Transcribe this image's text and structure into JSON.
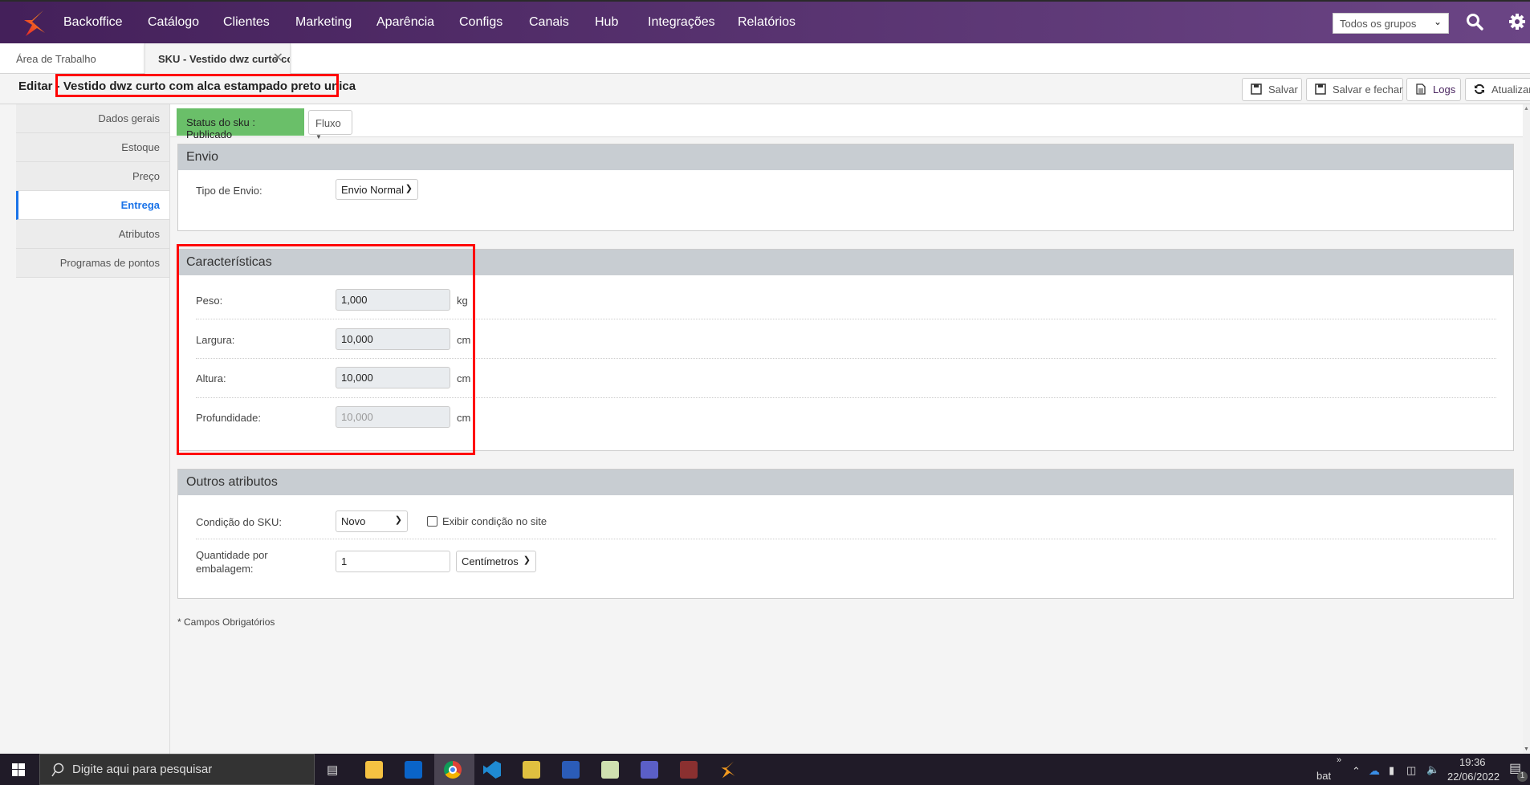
{
  "nav": {
    "items": [
      "Backoffice",
      "Catálogo",
      "Clientes",
      "Marketing",
      "Aparência",
      "Configs",
      "Canais",
      "Hub",
      "Integrações",
      "Relatórios"
    ],
    "group_select": "Todos os grupos",
    "colors": {
      "start": "#44205a",
      "end": "#6b4585"
    }
  },
  "tabs": {
    "workspace": "Área de Trabalho",
    "active": "SKU - Vestido dwz curto com alca estampado preto unica"
  },
  "header": {
    "title_prefix": "Editar - ",
    "title": "Vestido dwz curto com alca estampado preto unica"
  },
  "toolbar": {
    "save": "Salvar",
    "save_close": "Salvar e fechar",
    "logs": "Logs",
    "refresh": "Atualizar"
  },
  "sidebar": {
    "items": [
      "Dados gerais",
      "Estoque",
      "Preço",
      "Entrega",
      "Atributos",
      "Programas de pontos"
    ],
    "active": "Entrega"
  },
  "status": {
    "label": "Status do sku : Publicado",
    "flow": "Fluxo",
    "color": "#6abf69"
  },
  "envio": {
    "title": "Envio",
    "tipo_label": "Tipo de Envio:",
    "tipo_value": "Envio Normal"
  },
  "caracteristicas": {
    "title": "Características",
    "rows": [
      {
        "label": "Peso:",
        "value": "1,000",
        "unit": "kg"
      },
      {
        "label": "Largura:",
        "value": "10,000",
        "unit": "cm"
      },
      {
        "label": "Altura:",
        "value": "10,000",
        "unit": "cm"
      },
      {
        "label": "Profundidade:",
        "value": "10,000",
        "unit": "cm"
      }
    ]
  },
  "outros": {
    "title": "Outros atributos",
    "condicao_label": "Condição do SKU:",
    "condicao_value": "Novo",
    "exibir_label": "Exibir condição no site",
    "qtd_label1": "Quantidade por",
    "qtd_label2": "embalagem:",
    "qtd_value": "1",
    "unit_value": "Centímetros"
  },
  "footer_note": "* Campos Obrigatórios",
  "taskbar": {
    "search_placeholder": "Digite aqui para pesquisar",
    "tray_text": "bat",
    "time": "19:36",
    "date": "22/06/2022",
    "notifications": "1"
  }
}
